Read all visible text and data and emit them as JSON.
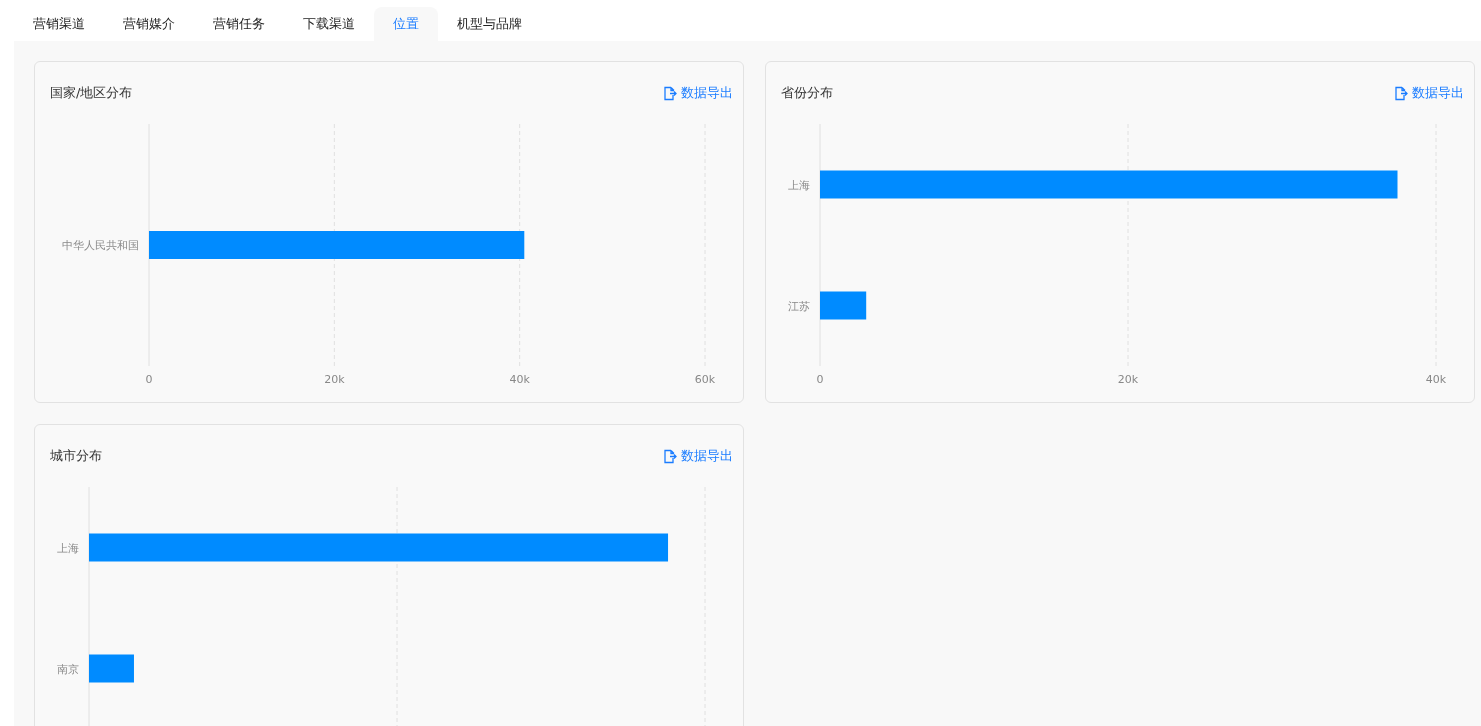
{
  "tabs": [
    {
      "label": "营销渠道",
      "selected": false
    },
    {
      "label": "营销媒介",
      "selected": false
    },
    {
      "label": "营销任务",
      "selected": false
    },
    {
      "label": "下载渠道",
      "selected": false
    },
    {
      "label": "位置",
      "selected": true
    },
    {
      "label": "机型与品牌",
      "selected": false
    }
  ],
  "panels": [
    {
      "title": "国家/地区分布",
      "export": "数据导出",
      "chart_data": {
        "type": "bar",
        "orientation": "horizontal",
        "categories": [
          "中华人民共和国"
        ],
        "series": [
          {
            "color": "#008bff",
            "values": [
              40500
            ]
          }
        ],
        "xlim": [
          0,
          60000
        ],
        "xticks": [
          {
            "value": 0,
            "label": "0"
          },
          {
            "value": 20000,
            "label": "20k"
          },
          {
            "value": 40000,
            "label": "40k"
          },
          {
            "value": 60000,
            "label": "60k"
          }
        ]
      }
    },
    {
      "title": "省份分布",
      "export": "数据导出",
      "chart_data": {
        "type": "bar",
        "orientation": "horizontal",
        "categories": [
          "上海",
          "江苏"
        ],
        "series": [
          {
            "color": "#008bff",
            "values": [
              37500,
              3000
            ]
          }
        ],
        "xlim": [
          0,
          40000
        ],
        "xticks": [
          {
            "value": 0,
            "label": "0"
          },
          {
            "value": 20000,
            "label": "20k"
          },
          {
            "value": 40000,
            "label": "40k"
          }
        ]
      }
    },
    {
      "title": "城市分布",
      "export": "数据导出",
      "bars": [
        {
          "label": "上海"
        },
        {
          "label": "南京"
        }
      ]
    }
  ]
}
